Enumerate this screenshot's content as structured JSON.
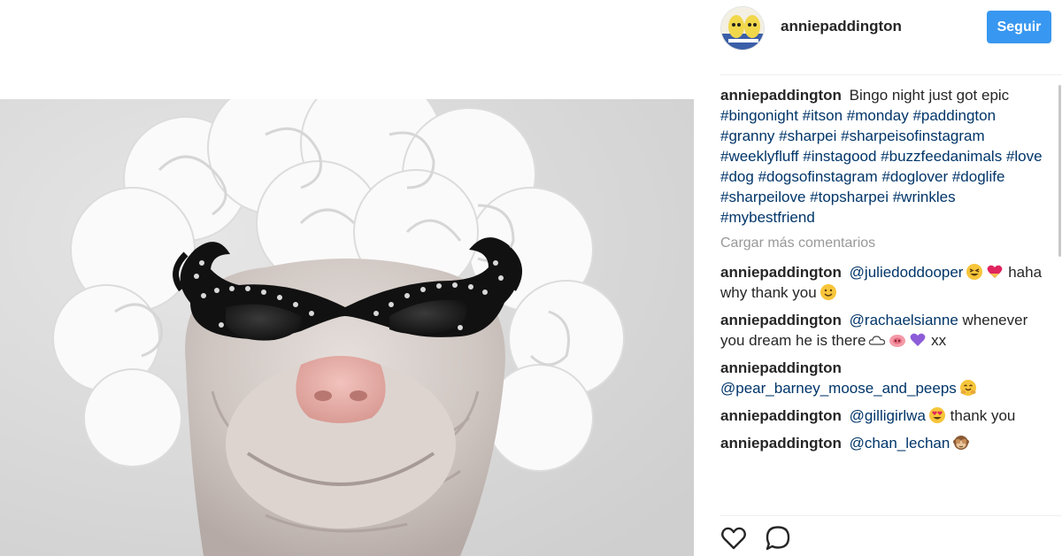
{
  "post": {
    "photo_alt": "Shar-pei dog wearing a white curly wig and black rhinestone cat-eye sunglasses"
  },
  "header": {
    "username": "anniepaddington",
    "follow_label": "Seguir"
  },
  "caption": {
    "author": "anniepaddington",
    "text": "Bingo night just got epic",
    "hashtags": [
      "#bingonight",
      "#itson",
      "#monday",
      "#paddington",
      "#granny",
      "#sharpei",
      "#sharpeisofinstagram",
      "#weeklyfluff",
      "#instagood",
      "#buzzfeedanimals",
      "#love",
      "#dog",
      "#dogsofinstagram",
      "#doglover",
      "#doglife",
      "#sharpeilove",
      "#topsharpei",
      "#wrinkles",
      "#mybestfriend"
    ]
  },
  "load_more": "Cargar más comentarios",
  "comments": [
    {
      "author": "anniepaddington",
      "mention": "@juliedoddooper",
      "text": "haha why thank you",
      "emojis_after_mention": [
        "squint-laugh-emoji",
        "red-heart-emoji"
      ],
      "emojis_after_text": [
        "smile-emoji"
      ]
    },
    {
      "author": "anniepaddington",
      "mention": "@rachaelsianne",
      "text": "whenever you dream he is there",
      "text_after": "xx",
      "emojis_after_text": [
        "cloud-emoji",
        "pig-nose-emoji",
        "purple-heart-emoji"
      ]
    },
    {
      "author": "anniepaddington",
      "mention": "@pear_barney_moose_and_peeps",
      "text": "",
      "emojis_after_mention": [
        "hugging-emoji"
      ]
    },
    {
      "author": "anniepaddington",
      "mention": "@gilligirlwa",
      "text": "thank you",
      "emojis_after_mention": [
        "heart-eyes-emoji"
      ]
    },
    {
      "author": "anniepaddington",
      "mention": "@chan_lechan",
      "text": "",
      "emojis_after_mention": [
        "see-no-evil-monkey-emoji"
      ]
    }
  ],
  "actions": {
    "like_icon": "heart-outline-icon",
    "comment_icon": "speech-bubble-icon"
  },
  "colors": {
    "follow_button": "#3897f0",
    "hashtag": "#003569",
    "muted": "#999999",
    "text": "#262626"
  }
}
